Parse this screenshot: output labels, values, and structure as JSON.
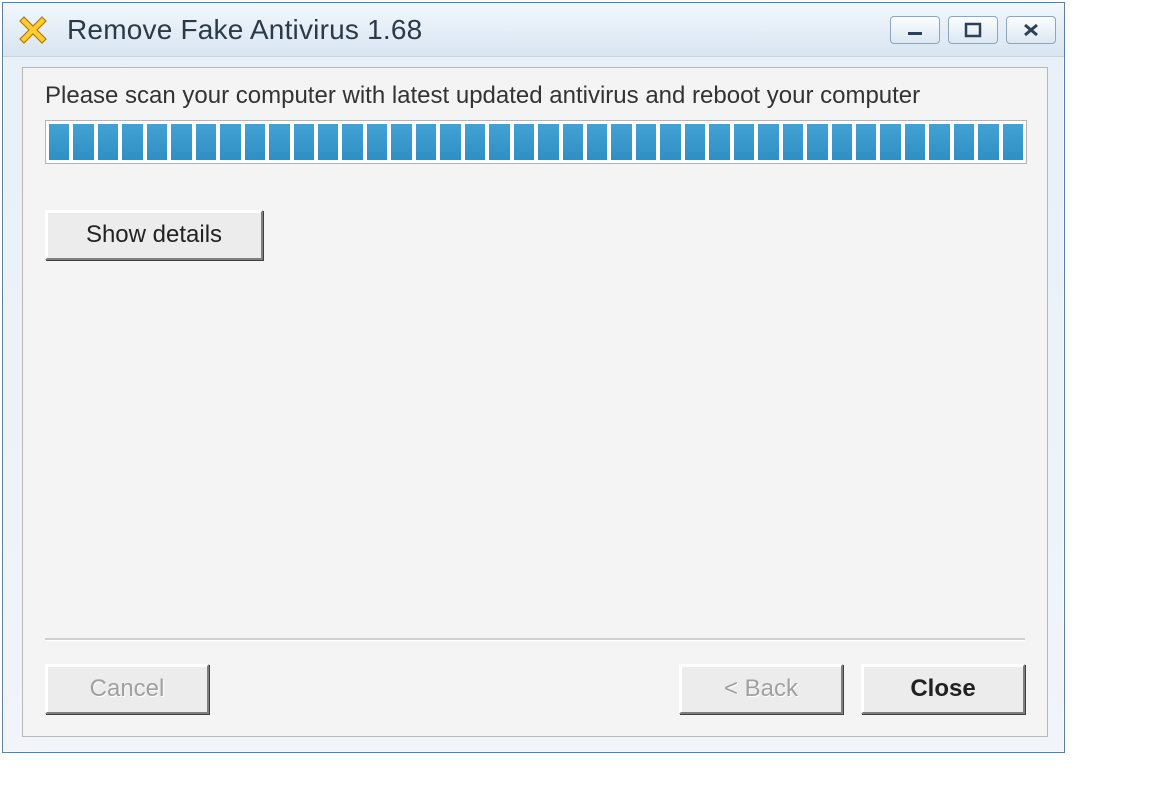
{
  "window": {
    "title": "Remove Fake Antivirus 1.68",
    "app_icon": "x-delete-icon"
  },
  "window_controls": {
    "minimize": "minimize-icon",
    "maximize": "maximize-icon",
    "close": "close-icon"
  },
  "instruction": "Please scan your computer with latest updated antivirus and reboot your computer",
  "progress": {
    "segments": 40,
    "filled": 40,
    "percent": 100
  },
  "buttons": {
    "show_details": "Show details",
    "cancel": "Cancel",
    "back": "< Back",
    "close": "Close"
  },
  "button_state": {
    "cancel_enabled": false,
    "back_enabled": false,
    "close_enabled": true
  }
}
